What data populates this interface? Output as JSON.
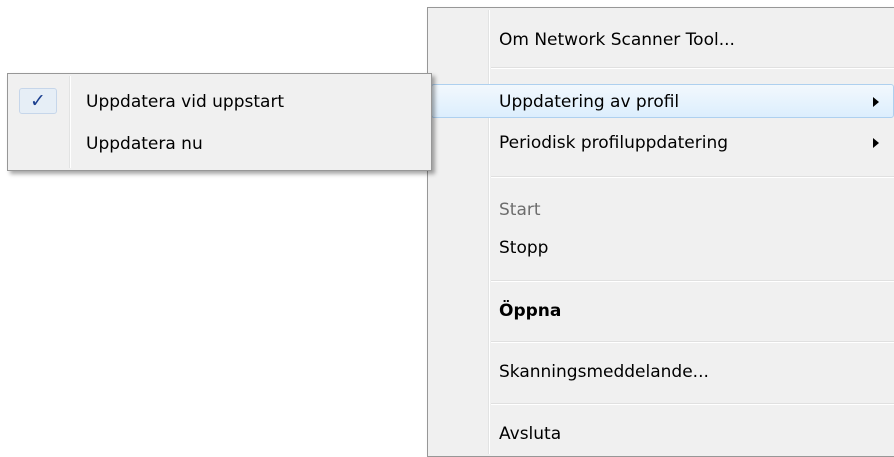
{
  "main_menu": {
    "items": [
      {
        "label": "Om Network Scanner Tool..."
      },
      {
        "label": "Uppdatering av profil",
        "submenu": true,
        "highlighted": true
      },
      {
        "label": "Periodisk profiluppdatering",
        "submenu": true
      },
      {
        "label": "Start",
        "disabled": true
      },
      {
        "label": "Stopp"
      },
      {
        "label": "Öppna",
        "bold": true
      },
      {
        "label": "Skanningsmeddelande..."
      },
      {
        "label": "Avsluta"
      }
    ]
  },
  "sub_menu": {
    "items": [
      {
        "label": "Uppdatera vid uppstart",
        "checked": true,
        "check_glyph": "✓"
      },
      {
        "label": "Uppdatera nu",
        "checked": false
      }
    ]
  }
}
